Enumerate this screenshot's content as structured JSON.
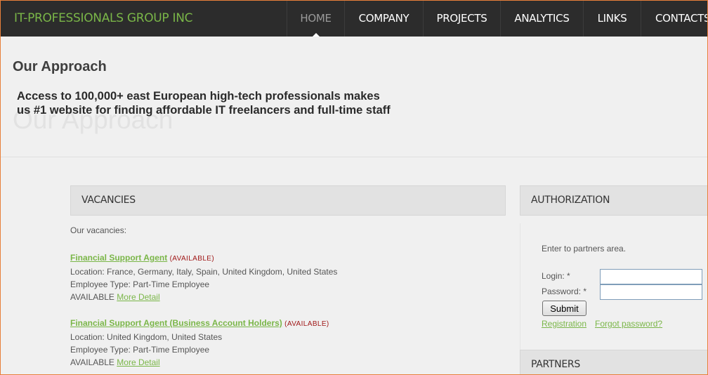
{
  "header": {
    "brand": "IT-PROFESSIONALS GROUP INC",
    "nav": [
      "HOME",
      "COMPANY",
      "PROJECTS",
      "ANALYTICS",
      "LINKS",
      "CONTACTS"
    ],
    "active": "HOME"
  },
  "hero": {
    "title": "Our Approach",
    "ghost_title": "Our Approach",
    "text_line1": "Access to 100,000+ east European high-tech professionals makes",
    "text_line2": "us #1 website for finding affordable IT freelancers and full-time staff"
  },
  "vacancies": {
    "heading": "VACANCIES",
    "intro": "Our vacancies:",
    "items": [
      {
        "title": "Financial Support Agent",
        "status": "(AVAILABLE)",
        "location": "Location: France, Germany, Italy, Spain, United Kingdom, United States",
        "type": "Employee Type: Part-Time Employee",
        "availability": "AVAILABLE",
        "more": "More Detail"
      },
      {
        "title": "Financial Support Agent (Business Account Holders)",
        "status": "(AVAILABLE)",
        "location": "Location: United Kingdom, United States",
        "type": "Employee Type: Part-Time Employee",
        "availability": "AVAILABLE",
        "more": "More Detail"
      }
    ]
  },
  "authorization": {
    "heading": "AUTHORIZATION",
    "intro": "Enter to partners area.",
    "login_label": "Login: *",
    "login_value": "",
    "password_label": "Password: *",
    "password_value": "",
    "submit": "Submit",
    "registration": "Registration",
    "forgot": "Forgot password?"
  },
  "partners": {
    "heading": "PARTNERS"
  },
  "colors": {
    "brand_green": "#7ab648",
    "header_bg": "#2c2c2c",
    "status_red": "#a01818"
  }
}
